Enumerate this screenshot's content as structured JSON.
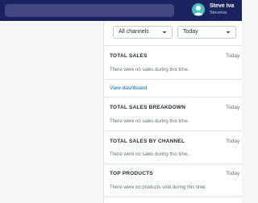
{
  "header": {
    "user_name": "Steve Iva",
    "user_handle": "Steveiva"
  },
  "filters": {
    "channel": "All channels",
    "date_range": "Today"
  },
  "cards": [
    {
      "title": "TOTAL SALES",
      "range": "Today",
      "empty": "There were no sales during this time.",
      "link": "View dashboard"
    },
    {
      "title": "TOTAL SALES BREAKDOWN",
      "range": "Today",
      "empty": "There were no sales during this time."
    },
    {
      "title": "TOTAL SALES BY CHANNEL",
      "range": "Today",
      "empty": "There were no sales during this time."
    },
    {
      "title": "TOP PRODUCTS",
      "range": "Today",
      "empty": "There were no products sold during this time."
    }
  ]
}
